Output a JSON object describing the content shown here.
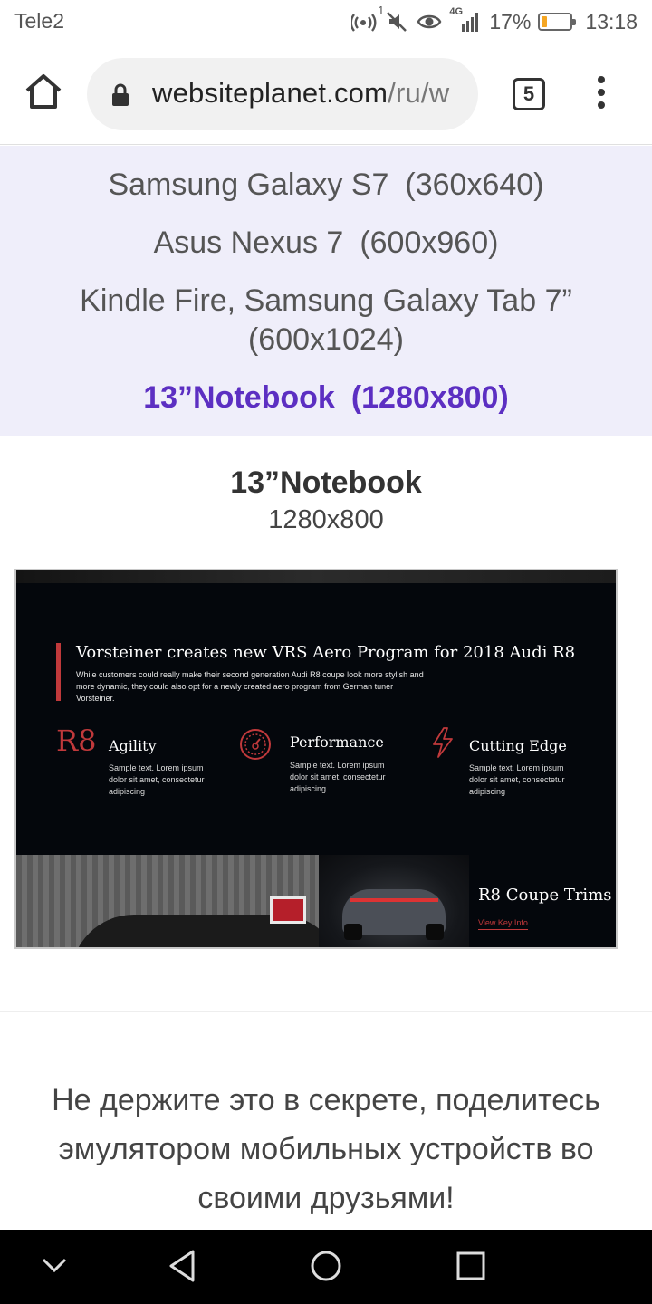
{
  "status_bar": {
    "carrier": "Tele2",
    "hotspot_badge": "1",
    "network": "4G",
    "battery_percent": "17%",
    "battery_level": 0.17,
    "time": "13:18",
    "battery_color": "#f5a623"
  },
  "browser": {
    "url_host": "websiteplanet.com",
    "url_path": "/ru/w",
    "tab_count": "5",
    "icons": [
      "home-icon",
      "lock-icon",
      "tabs-icon",
      "overflow-menu-icon"
    ]
  },
  "devices": {
    "items": [
      {
        "name": "Samsung Galaxy S7",
        "res": "(360x640)"
      },
      {
        "name": "Asus Nexus 7",
        "res": "(600x960)"
      },
      {
        "name": "Kindle Fire, Samsung Galaxy Tab 7”",
        "res": "(600x1024)"
      },
      {
        "name": "13”Notebook",
        "res": "(1280x800)"
      }
    ],
    "selected_color": "#5c2fc2"
  },
  "preview": {
    "title": "13”Notebook",
    "resolution": "1280x800",
    "site": {
      "headline": "Vorsteiner creates new VRS Aero Program for 2018 Audi R8",
      "lead": "While customers could really make their second generation Audi R8 coupe look more stylish and more dynamic, they could also opt for a newly created aero program from German tuner Vorsteiner.",
      "accent": "#c0393b",
      "features": [
        {
          "icon": "R8",
          "title": "Agility",
          "text": "Sample text. Lorem ipsum dolor sit amet, consectetur adipiscing"
        },
        {
          "icon": "speedometer-icon",
          "title": "Performance",
          "text": "Sample text. Lorem ipsum dolor sit amet, consectetur adipiscing"
        },
        {
          "icon": "lightning-icon",
          "title": "Cutting Edge",
          "text": "Sample text. Lorem ipsum dolor sit amet, consectetur adipiscing"
        }
      ],
      "trims_title": "R8 Coupe Trims",
      "trims_link": "View Key Info"
    }
  },
  "share_text": "Не держите это в секрете, поделитесь эмулятором мобильных устройств во своими друзьями!",
  "nav_bar": {
    "icons": [
      "hide-keyboard-icon",
      "back-icon",
      "home-circle-icon",
      "recents-icon"
    ]
  }
}
